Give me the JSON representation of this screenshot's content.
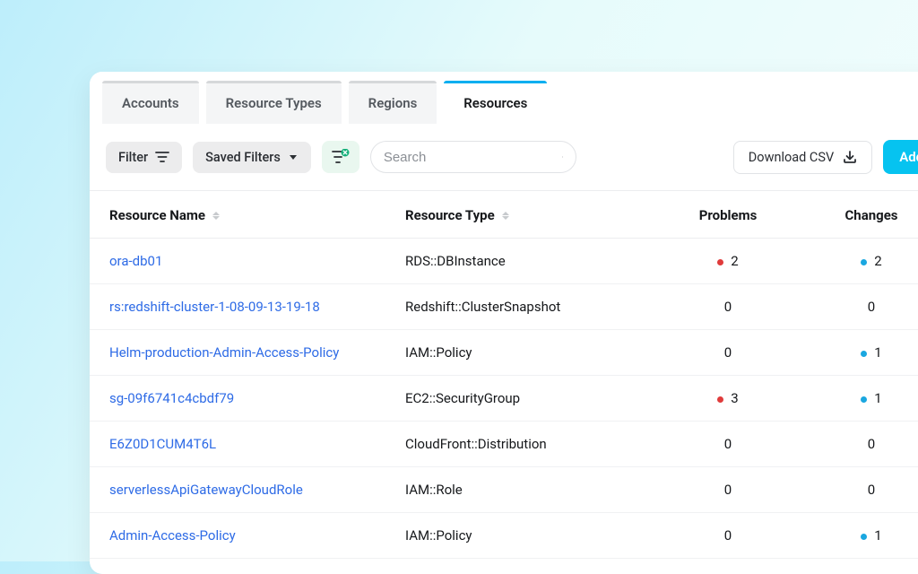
{
  "tabs": [
    {
      "label": "Accounts",
      "active": false
    },
    {
      "label": "Resource Types",
      "active": false
    },
    {
      "label": "Regions",
      "active": false
    },
    {
      "label": "Resources",
      "active": true
    }
  ],
  "toolbar": {
    "filter_label": "Filter",
    "saved_filters_label": "Saved Filters",
    "search_placeholder": "Search",
    "download_csv_label": "Download CSV",
    "add_account_label": "Add Acco"
  },
  "columns": {
    "name": "Resource Name",
    "type": "Resource Type",
    "problems": "Problems",
    "changes": "Changes"
  },
  "rows": [
    {
      "name": "ora-db01",
      "type": "RDS::DBInstance",
      "problems": 2,
      "problems_flag": true,
      "changes": 2,
      "changes_flag": true
    },
    {
      "name": "rs:redshift-cluster-1-08-09-13-19-18",
      "type": "Redshift::ClusterSnapshot",
      "problems": 0,
      "problems_flag": false,
      "changes": 0,
      "changes_flag": false
    },
    {
      "name": "Helm-production-Admin-Access-Policy",
      "type": "IAM::Policy",
      "problems": 0,
      "problems_flag": false,
      "changes": 1,
      "changes_flag": true
    },
    {
      "name": "sg-09f6741c4cbdf79",
      "type": "EC2::SecurityGroup",
      "problems": 3,
      "problems_flag": true,
      "changes": 1,
      "changes_flag": true
    },
    {
      "name": "E6Z0D1CUM4T6L",
      "type": "CloudFront::Distribution",
      "problems": 0,
      "problems_flag": false,
      "changes": 0,
      "changes_flag": false
    },
    {
      "name": "serverlessApiGatewayCloudRole",
      "type": "IAM::Role",
      "problems": 0,
      "problems_flag": false,
      "changes": 0,
      "changes_flag": false
    },
    {
      "name": "Admin-Access-Policy",
      "type": "IAM::Policy",
      "problems": 0,
      "problems_flag": false,
      "changes": 1,
      "changes_flag": true
    }
  ]
}
